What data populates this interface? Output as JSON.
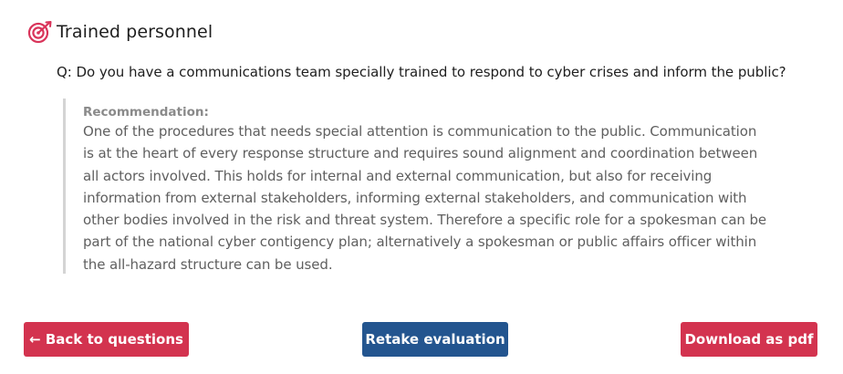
{
  "section": {
    "title": "Trained personnel",
    "icon": "target-icon",
    "icon_color": "#d9345a"
  },
  "question": "Q: Do you have a communications team specially trained to respond to cyber crises and inform the public?",
  "recommendation": {
    "label": "Recommendation:",
    "lines": [
      "One of the procedures that needs special attention is communication to the public. Communication",
      "is at the heart of every response structure and requires sound alignment and coordination between",
      "all actors involved. This holds for internal and external communication, but also for receiving",
      "information from external stakeholders, informing external stakeholders, and communication with",
      "other bodies involved in the risk and threat system. Therefore a specific role for a spokesman can be",
      "part of the national cyber contigency plan; alternatively a spokesman or public affairs officer within",
      "the all-hazard structure can be used."
    ]
  },
  "buttons": {
    "back_label": "← Back to questions",
    "retake_label": "Retake evaluation",
    "pdf_label": "Download as pdf"
  },
  "colors": {
    "primary_red": "#d3334f",
    "primary_blue": "#23558f",
    "quote_border": "#d4d4d4"
  }
}
